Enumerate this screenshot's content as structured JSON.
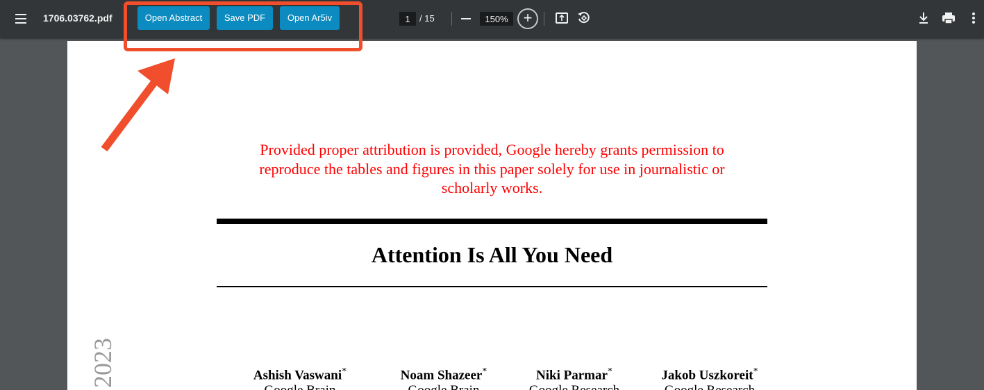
{
  "toolbar": {
    "filename": "1706.03762.pdf",
    "extension_buttons": {
      "open_abstract": "Open Abstract",
      "save_pdf": "Save PDF",
      "open_arxiv": "Open Ar5iv"
    },
    "page_current": "1",
    "page_total": "/ 15",
    "zoom": "150%"
  },
  "icons": {
    "menu": "hamburger-menu-icon",
    "zoom_out": "minus-icon",
    "zoom_in": "plus-icon",
    "fit": "fit-to-page-icon",
    "rotate": "rotate-icon",
    "download": "download-icon",
    "print": "print-icon",
    "more": "more-vertical-icon"
  },
  "annotation": {
    "color": "#f04e2d"
  },
  "colors": {
    "toolbar_bg": "#323639",
    "viewer_bg": "#525659",
    "button_bg": "#0b8bbf",
    "notice_text": "#ff0000"
  },
  "document": {
    "notice_lines": [
      "Provided proper attribution is provided, Google hereby grants permission to",
      "reproduce the tables and figures in this paper solely for use in journalistic or",
      "scholarly works."
    ],
    "title": "Attention Is All You Need",
    "side_year": "2023",
    "authors": [
      {
        "name": "Ashish Vaswani",
        "mark": "*",
        "affiliation": "Google Brain"
      },
      {
        "name": "Noam Shazeer",
        "mark": "*",
        "affiliation": "Google Brain"
      },
      {
        "name": "Niki Parmar",
        "mark": "*",
        "affiliation": "Google Research"
      },
      {
        "name": "Jakob Uszkoreit",
        "mark": "*",
        "affiliation": "Google Research"
      }
    ]
  }
}
